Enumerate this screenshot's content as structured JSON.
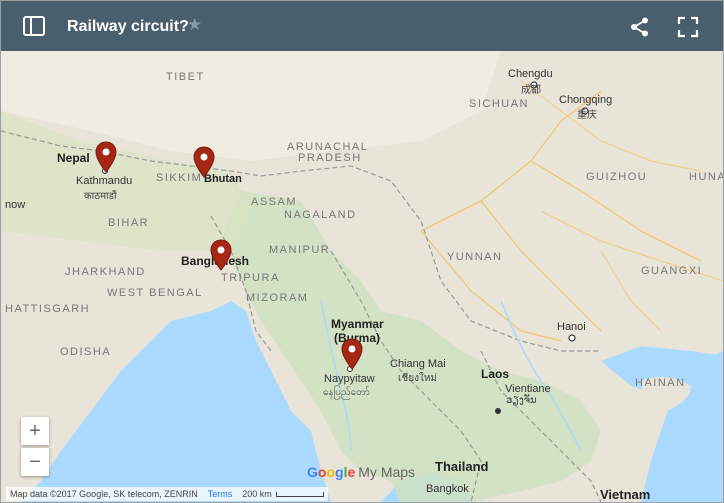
{
  "title": "Railway circuit?",
  "icons": {
    "sidebar": "sidebar-toggle-icon",
    "star": "star-icon",
    "share": "share-icon",
    "fullscreen": "fullscreen-icon"
  },
  "map": {
    "labels": {
      "tibet": "TIBET",
      "chengdu": "Chengdu",
      "chengdu_zh": "成都",
      "sichuan": "SICHUAN",
      "chongqing": "Chongqing",
      "chongqing_zh": "重庆",
      "nepal": "Nepal",
      "kathmandu": "Kathmandu",
      "kathmandu_np": "काठमाडौं",
      "sikkim": "SIKKIM",
      "bhutan": "Bhutan",
      "arunachal": "ARUNACHAL",
      "pradesh": "PRADESH",
      "guizhou": "GUIZHOU",
      "hunan": "HUNAN",
      "now": "now",
      "bihar": "BIHAR",
      "assam": "ASSAM",
      "nagaland": "NAGALAND",
      "manipur": "MANIPUR",
      "bangladesh": "Bangladesh",
      "tripura": "TRIPURA",
      "yunnan": "YUNNAN",
      "jharkhand": "JHARKHAND",
      "guangxi": "GUANGXI",
      "west_bengal": "WEST BENGAL",
      "mizoram": "MIZORAM",
      "hattisgarh": "HATTISGARH",
      "odisha": "ODISHA",
      "myanmar": "Myanmar",
      "burma": "(Burma)",
      "hanoi": "Hanoi",
      "chiang_mai": "Chiang Mai",
      "chiang_mai_th": "เชียงใหม่",
      "naypyitaw": "Naypyitaw",
      "naypyitaw_my": "နေပြည်တော်",
      "laos": "Laos",
      "vientiane": "Vientiane",
      "vientiane_lo": "ວຽງຈັນ",
      "hainan": "HAINAN",
      "thailand": "Thailand",
      "bangkok": "Bangkok",
      "vietnam": "Vietnam"
    },
    "markers": [
      "Kathmandu",
      "Bhutan",
      "Bangladesh",
      "Naypyitaw"
    ],
    "marker_color": "#a52714",
    "zoom_in": "+",
    "zoom_out": "−",
    "logo": {
      "g": "G",
      "o1": "o",
      "o2": "o",
      "g2": "g",
      "l": "l",
      "e": "e",
      "mymaps": "My Maps"
    },
    "attribution": {
      "data": "Map data ©2017 Google, SK telecom, ZENRIN",
      "terms": "Terms",
      "scale": "200 km"
    }
  }
}
